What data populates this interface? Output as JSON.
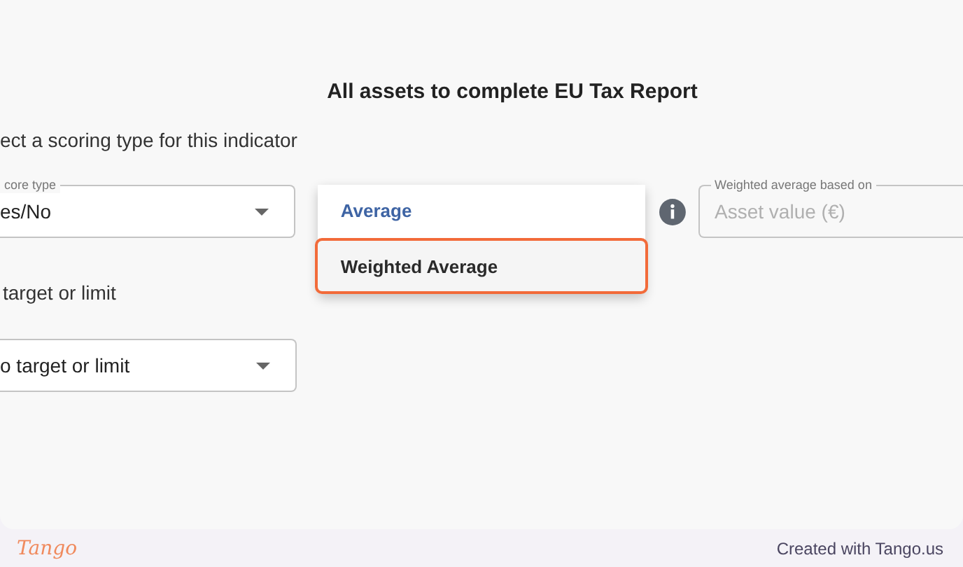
{
  "title": "All assets to complete EU Tax Report",
  "scoring_prompt": "ect a scoring type for this indicator",
  "score_type": {
    "label": "core type",
    "value": "es/No"
  },
  "accumulation_menu": {
    "items": [
      {
        "label": "Average",
        "selected": true,
        "highlighted": false
      },
      {
        "label": "Weighted Average",
        "selected": false,
        "highlighted": true
      }
    ]
  },
  "weighted_average_field": {
    "label": "Weighted average based on",
    "placeholder": "Asset value (€)"
  },
  "target_prompt": "target or limit",
  "target_field": {
    "value": "o target or limit"
  },
  "footer": {
    "logo": "Tango",
    "credit": "Created with Tango.us"
  }
}
